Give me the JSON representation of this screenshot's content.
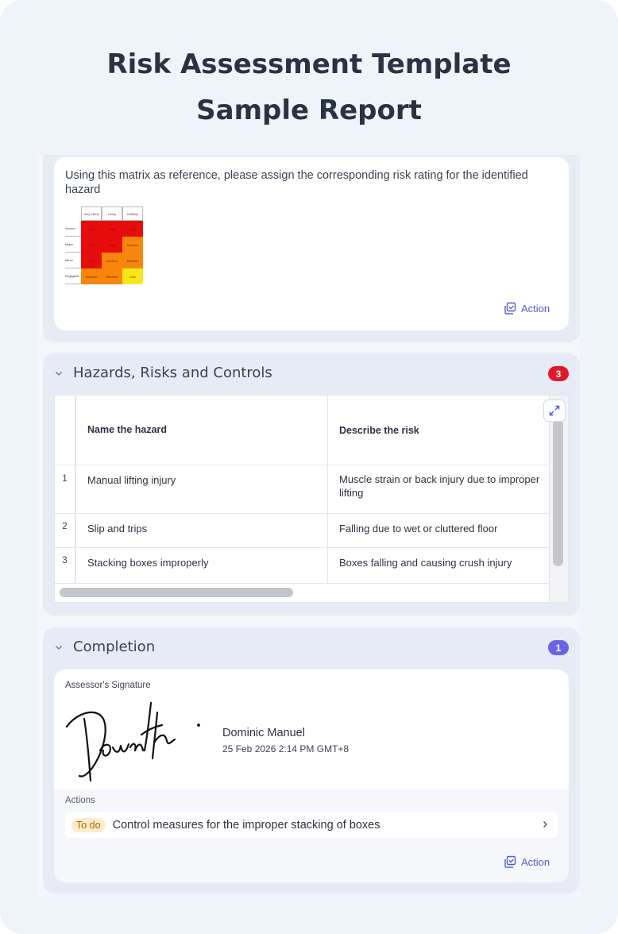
{
  "title": {
    "line1": "Risk Assessment Template",
    "line2": "Sample Report"
  },
  "matrix_question": {
    "text": "Using this matrix as reference, please assign the corresponding risk rating for the identified hazard",
    "action_label": "Action",
    "matrix_image": {
      "column_headers": [
        "Very Likely",
        "Likely",
        "Unlikely"
      ],
      "row_headers": [
        "Severe",
        "Major",
        "Minor",
        "Negligible"
      ],
      "cells": [
        [
          "High",
          "High",
          "High"
        ],
        [
          "High",
          "High",
          "Medium"
        ],
        [
          "High",
          "Medium",
          "Medium"
        ],
        [
          "Medium",
          "Medium",
          "Low"
        ]
      ],
      "colors": {
        "high": "#e80d0d",
        "medium": "#f7860a",
        "low": "#f5e81a"
      }
    }
  },
  "hazards": {
    "title": "Hazards, Risks and Controls",
    "count": "3",
    "badge_color": "#e0192a",
    "columns": [
      "Name the hazard",
      "Describe the risk"
    ],
    "rows": [
      {
        "num": "1",
        "hazard": "Manual lifting injury",
        "risk": "Muscle strain or back injury due to improper lifting"
      },
      {
        "num": "2",
        "hazard": "Slip and trips",
        "risk": "Falling due to wet or cluttered floor"
      },
      {
        "num": "3",
        "hazard": "Stacking boxes improperly",
        "risk": "Boxes falling and causing crush injury"
      }
    ]
  },
  "completion": {
    "title": "Completion",
    "count": "1",
    "badge_color": "#6a63e8",
    "signature_label": "Assessor's Signature",
    "signer_name": "Dominic Manuel",
    "signed_at": "25 Feb 2026 2:14 PM GMT+8",
    "actions_label": "Actions",
    "todo_badge": "To do",
    "todo_text": "Control measures for the improper stacking of boxes",
    "action_label": "Action"
  }
}
